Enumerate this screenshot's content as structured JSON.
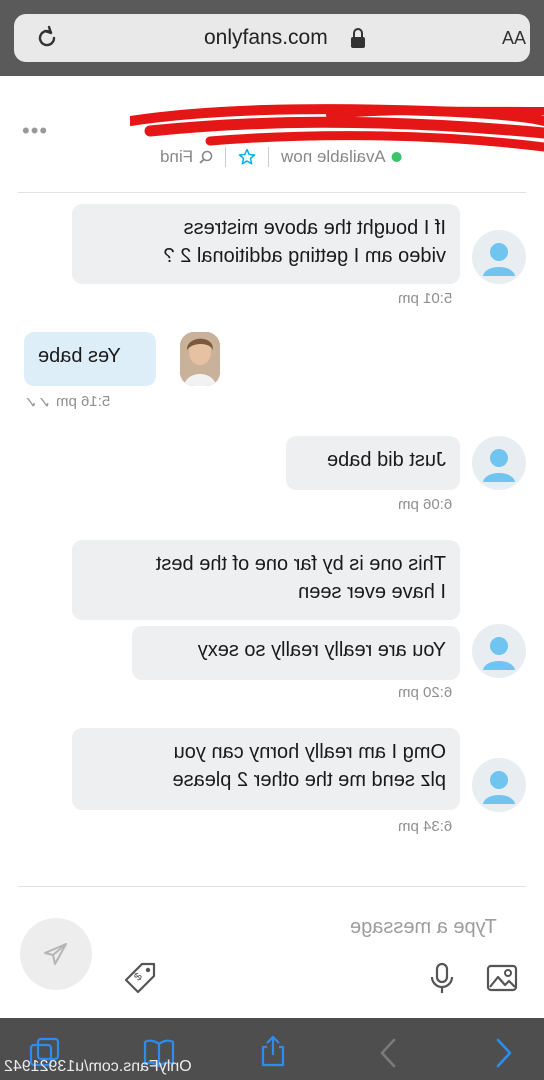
{
  "browser": {
    "url": "onlyfans.com",
    "text_size_label": "AA",
    "bottom_url": "OnlyFans.com/u13921942"
  },
  "header": {
    "more_label": "•••",
    "status": "Available now",
    "find_label": "Find"
  },
  "messages": [
    {
      "side": "fan",
      "text_lines": [
        "If I bought the above mistress",
        "video am I getting additional 2 ?"
      ],
      "time": "5:01 pm"
    },
    {
      "side": "creator",
      "text_lines": [
        "Yes babe"
      ],
      "time": "5:16 pm"
    },
    {
      "side": "fan",
      "text_lines": [
        "Just did babe"
      ],
      "time": "6:06 pm"
    },
    {
      "side": "fan",
      "text_lines": [
        "This one is by far one of the best",
        "I have ever seen"
      ],
      "time": ""
    },
    {
      "side": "fan",
      "text_lines": [
        "You are really really so sexy"
      ],
      "time": "6:20 pm"
    },
    {
      "side": "fan",
      "text_lines": [
        "Omg I am really horny can you",
        "plz send me the other 2 please"
      ],
      "time": "6:34 pm"
    }
  ],
  "composer": {
    "placeholder": "Type a message"
  },
  "colors": {
    "online": "#3cc36a",
    "accent": "#00aff0",
    "fan_bubble": "#eeeff1",
    "creator_bubble": "#ddeef9"
  }
}
